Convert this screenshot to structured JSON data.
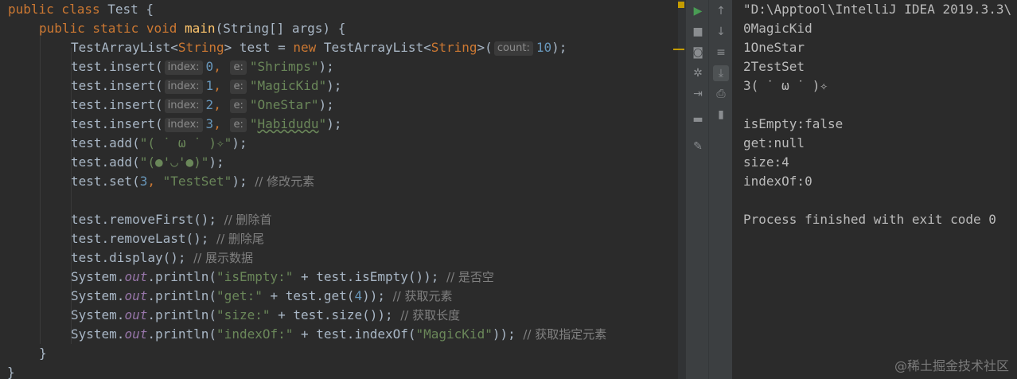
{
  "code": {
    "l1": {
      "kw1": "public class ",
      "name": "Test {"
    },
    "l2": {
      "kw": "public static void ",
      "fn": "main",
      "rest": "(String[] args) {"
    },
    "l3": {
      "a": "TestArrayList<",
      "kw1": "String",
      "b": "> test = ",
      "kw2": "new ",
      "c": "TestArrayList<",
      "kw3": "String",
      "d": ">(",
      "hint": "count:",
      "num": "10",
      "e": ");"
    },
    "l4": {
      "a": "test.insert(",
      "hint1": "index:",
      "num": "0",
      "sep": ", ",
      "hint2": "e:",
      "str": "\"Shrimps\"",
      "e": ");"
    },
    "l5": {
      "a": "test.insert(",
      "hint1": "index:",
      "num": "1",
      "sep": ", ",
      "hint2": "e:",
      "str": "\"MagicKid\"",
      "e": ");"
    },
    "l6": {
      "a": "test.insert(",
      "hint1": "index:",
      "num": "2",
      "sep": ", ",
      "hint2": "e:",
      "str": "\"OneStar\"",
      "e": ");"
    },
    "l7": {
      "a": "test.insert(",
      "hint1": "index:",
      "num": "3",
      "sep": ", ",
      "hint2": "e:",
      "q1": "\"",
      "str": "Habidudu",
      "q2": "\"",
      "e": ");"
    },
    "l8": {
      "a": "test.add(",
      "str": "\"( ˙ ω ˙ )✧\"",
      "e": ");"
    },
    "l9": {
      "a": "test.add(",
      "str": "\"(●'◡'●)\"",
      "e": ");"
    },
    "l10": {
      "a": "test.set(",
      "num": "3",
      "sep": ", ",
      "str": "\"TestSet\"",
      "e": "); ",
      "cmt": "// 修改元素"
    },
    "l12": {
      "a": "test.removeFirst(); ",
      "cmt": "// 删除首"
    },
    "l13": {
      "a": "test.removeLast(); ",
      "cmt": "// 删除尾"
    },
    "l14": {
      "a": "test.display(); ",
      "cmt": "// 展示数据"
    },
    "l15": {
      "a": "System.",
      "f": "out",
      "b": ".println(",
      "str": "\"isEmpty:\"",
      "c": " + test.isEmpty()); ",
      "cmt": "// 是否空"
    },
    "l16": {
      "a": "System.",
      "f": "out",
      "b": ".println(",
      "str": "\"get:\"",
      "c": " + test.get(",
      "num": "4",
      "d": ")); ",
      "cmt": "// 获取元素"
    },
    "l17": {
      "a": "System.",
      "f": "out",
      "b": ".println(",
      "str": "\"size:\"",
      "c": " + test.size()); ",
      "cmt": "// 获取长度"
    },
    "l18": {
      "a": "System.",
      "f": "out",
      "b": ".println(",
      "str": "\"indexOf:\"",
      "c": " + test.indexOf(",
      "str2": "\"MagicKid\"",
      "d": ")); ",
      "cmt": "// 获取指定元素"
    },
    "l19": "}",
    "l20": "}"
  },
  "console": {
    "lines": [
      "\"D:\\Apptool\\IntelliJ IDEA 2019.3.3\\",
      "0MagicKid",
      "1OneStar",
      "2TestSet",
      "3( ˙ ω ˙ )✧",
      "",
      "isEmpty:false",
      "get:null",
      "size:4",
      "indexOf:0",
      "",
      "Process finished with exit code 0"
    ]
  },
  "toolbar": {
    "run_icon": "play-icon",
    "stop_icon": "stop-icon",
    "up_icon": "arrow-up-icon",
    "down_icon": "arrow-down-icon",
    "camera_icon": "camera-icon",
    "wrap_icon": "soft-wrap-icon",
    "settings_icon": "gear-icon",
    "scroll_icon": "scroll-to-end-icon",
    "exit_icon": "exit-icon",
    "print_icon": "print-icon",
    "trash_icon": "trash-icon",
    "layout_icon": "layout-icon",
    "pin_icon": "pin-icon"
  },
  "watermark": "@稀土掘金技术社区",
  "colors": {
    "keyword": "#cc7832",
    "string": "#6a8759",
    "number": "#6897bb",
    "method": "#ffc66d",
    "field": "#9876aa",
    "comment": "#808080"
  }
}
